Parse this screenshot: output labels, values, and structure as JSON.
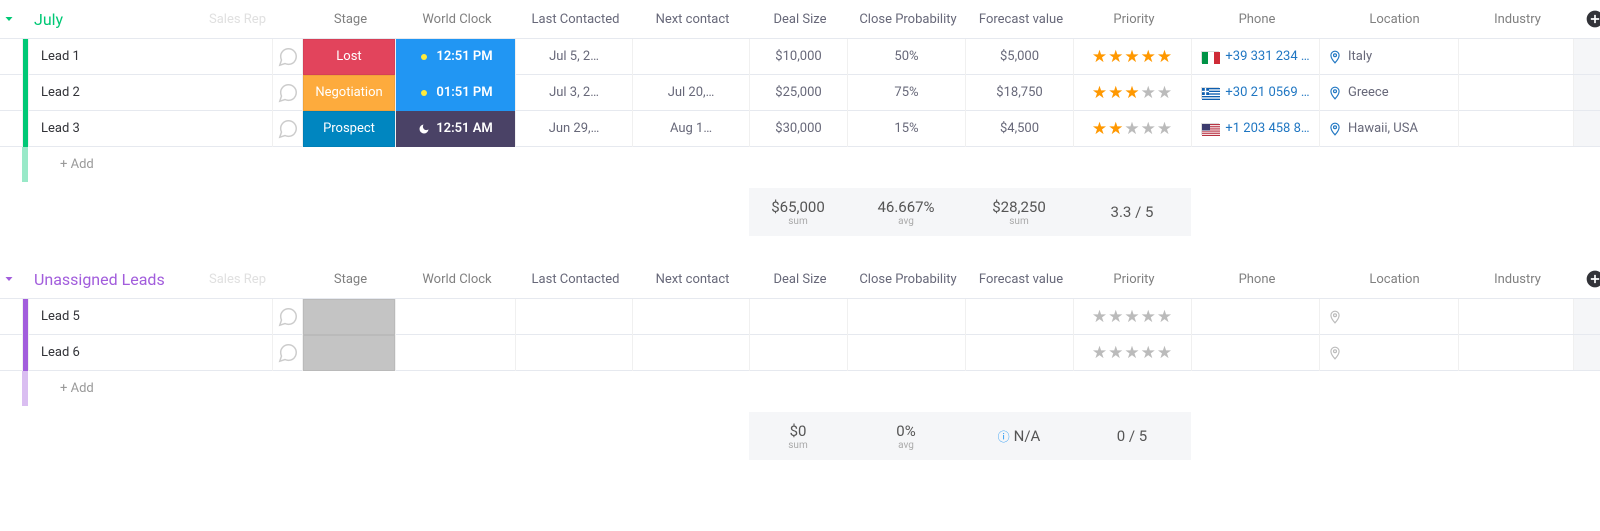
{
  "groups": [
    {
      "id": "july",
      "title": "July",
      "color": "#00c875",
      "headers": {
        "salesrep": "Sales Rep",
        "stage": "Stage",
        "clock": "World Clock",
        "last": "Last Contacted",
        "next": "Next contact",
        "deal": "Deal Size",
        "prob": "Close Probability",
        "fore": "Forecast value",
        "prio": "Priority",
        "phone": "Phone",
        "loc": "Location",
        "ind": "Industry"
      },
      "rows": [
        {
          "ind": "#00c875",
          "name": "Lead 1",
          "stage": {
            "label": "Lost",
            "bg": "#e2445c"
          },
          "clock": {
            "label": "12:51 PM",
            "bg": "#2196f3",
            "icon": "sun"
          },
          "last": "Jul 5, 2…",
          "next": "",
          "deal": "$10,000",
          "prob": "50%",
          "fore": "$5,000",
          "stars": 5,
          "flag": "it",
          "phone": "+39 331 234 …",
          "loc": "Italy"
        },
        {
          "ind": "#00c875",
          "name": "Lead 2",
          "stage": {
            "label": "Negotiation",
            "bg": "#fdab3d"
          },
          "clock": {
            "label": "01:51 PM",
            "bg": "#2196f3",
            "icon": "sun"
          },
          "last": "Jul 3, 2…",
          "next": "Jul 20,…",
          "deal": "$25,000",
          "prob": "75%",
          "fore": "$18,750",
          "stars": 3,
          "flag": "gr",
          "phone": "+30 21 0569 …",
          "loc": "Greece"
        },
        {
          "ind": "#00c875",
          "name": "Lead 3",
          "stage": {
            "label": "Prospect",
            "bg": "#0086c0"
          },
          "clock": {
            "label": "12:51 AM",
            "bg": "#4a4266",
            "icon": "moon"
          },
          "last": "Jun 29,…",
          "next": "Aug 1…",
          "deal": "$30,000",
          "prob": "15%",
          "fore": "$4,500",
          "stars": 2,
          "flag": "us",
          "phone": "+1 203 458 8…",
          "loc": "Hawaii, USA"
        }
      ],
      "add": "+ Add",
      "summary": {
        "deal": {
          "v": "$65,000",
          "l": "sum"
        },
        "prob": {
          "v": "46.667%",
          "l": "avg"
        },
        "fore": {
          "v": "$28,250",
          "l": "sum"
        },
        "prio": {
          "v": "3.3 / 5",
          "l": ""
        }
      }
    },
    {
      "id": "unassigned",
      "title": "Unassigned Leads",
      "color": "#a25ddc",
      "headers": {
        "salesrep": "Sales Rep",
        "stage": "Stage",
        "clock": "World Clock",
        "last": "Last Contacted",
        "next": "Next contact",
        "deal": "Deal Size",
        "prob": "Close Probability",
        "fore": "Forecast value",
        "prio": "Priority",
        "phone": "Phone",
        "loc": "Location",
        "ind": "Industry"
      },
      "rows": [
        {
          "ind": "#a25ddc",
          "name": "Lead 5",
          "stage": {
            "label": "",
            "bg": "#c4c4c4"
          },
          "clock": null,
          "last": "",
          "next": "",
          "deal": "",
          "prob": "",
          "fore": "",
          "stars": 0,
          "flag": null,
          "phone": "",
          "loc": ""
        },
        {
          "ind": "#a25ddc",
          "name": "Lead 6",
          "stage": {
            "label": "",
            "bg": "#c4c4c4"
          },
          "clock": null,
          "last": "",
          "next": "",
          "deal": "",
          "prob": "",
          "fore": "",
          "stars": 0,
          "flag": null,
          "phone": "",
          "loc": ""
        }
      ],
      "add": "+ Add",
      "summary": {
        "deal": {
          "v": "$0",
          "l": "sum"
        },
        "prob": {
          "v": "0%",
          "l": "avg"
        },
        "fore": {
          "v": "N/A",
          "l": "",
          "info": true
        },
        "prio": {
          "v": "0 / 5",
          "l": ""
        }
      }
    }
  ]
}
